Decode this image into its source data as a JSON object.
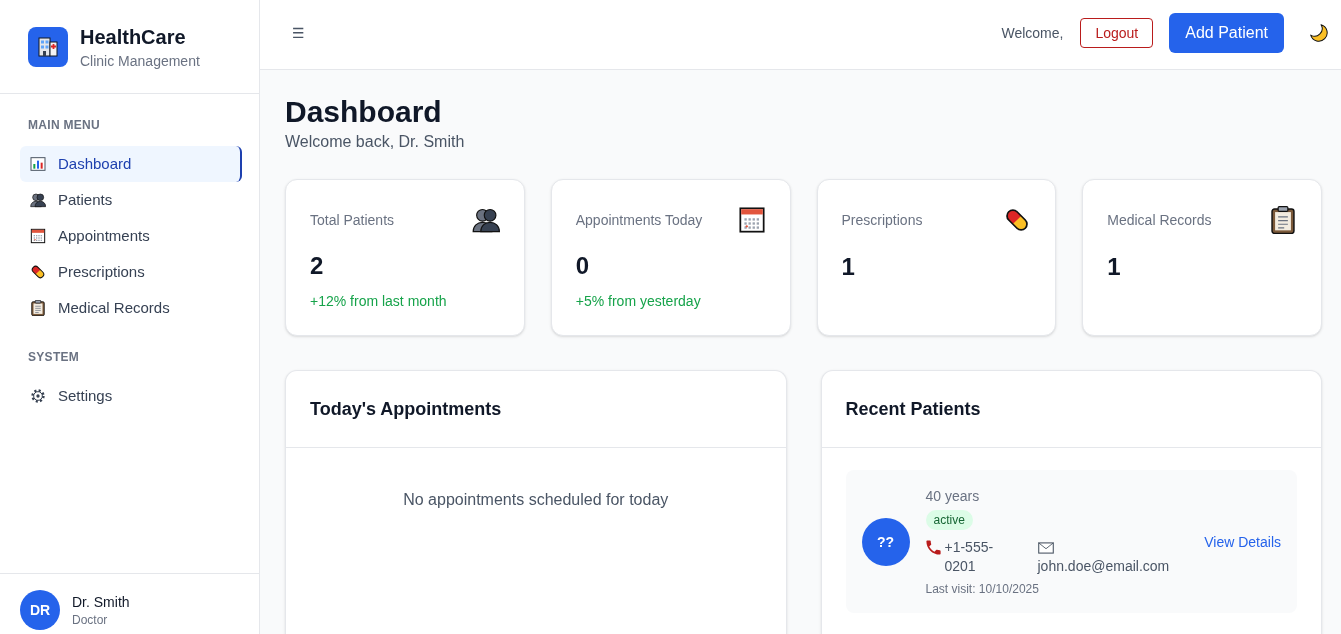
{
  "sidebar": {
    "brand": {
      "title": "HealthCare",
      "subtitle": "Clinic Management"
    },
    "sections": [
      {
        "heading": "MAIN MENU",
        "items": [
          {
            "label": "Dashboard",
            "selected": true
          },
          {
            "label": "Patients",
            "selected": false
          },
          {
            "label": "Appointments",
            "selected": false
          },
          {
            "label": "Prescriptions",
            "selected": false
          },
          {
            "label": "Medical Records",
            "selected": false
          }
        ]
      },
      {
        "heading": "SYSTEM",
        "items": [
          {
            "label": "Settings",
            "selected": false
          }
        ]
      }
    ],
    "user": {
      "initials": "DR",
      "name": "Dr. Smith",
      "role": "Doctor"
    }
  },
  "topbar": {
    "menu_glyph": "☰",
    "welcome": "Welcome,",
    "logout": "Logout",
    "add_button": "Add Patient"
  },
  "page": {
    "title": "Dashboard",
    "subtitle": "Welcome back, Dr. Smith"
  },
  "stats": [
    {
      "label": "Total Patients",
      "value": "2",
      "change": "+12% from last month"
    },
    {
      "label": "Appointments Today",
      "value": "0",
      "change": "+5% from yesterday"
    },
    {
      "label": "Prescriptions",
      "value": "1"
    },
    {
      "label": "Medical Records",
      "value": "1"
    }
  ],
  "appointments": {
    "title": "Today's Appointments",
    "empty_message": "No appointments scheduled for today"
  },
  "recent_patients": {
    "title": "Recent Patients",
    "patients": [
      {
        "initials": "??",
        "age": "40 years",
        "status": "active",
        "phone": "+1-555-0201",
        "email": "john.doe@email.com",
        "last_visit": "Last visit: 10/10/2025",
        "action": "View Details"
      }
    ]
  }
}
